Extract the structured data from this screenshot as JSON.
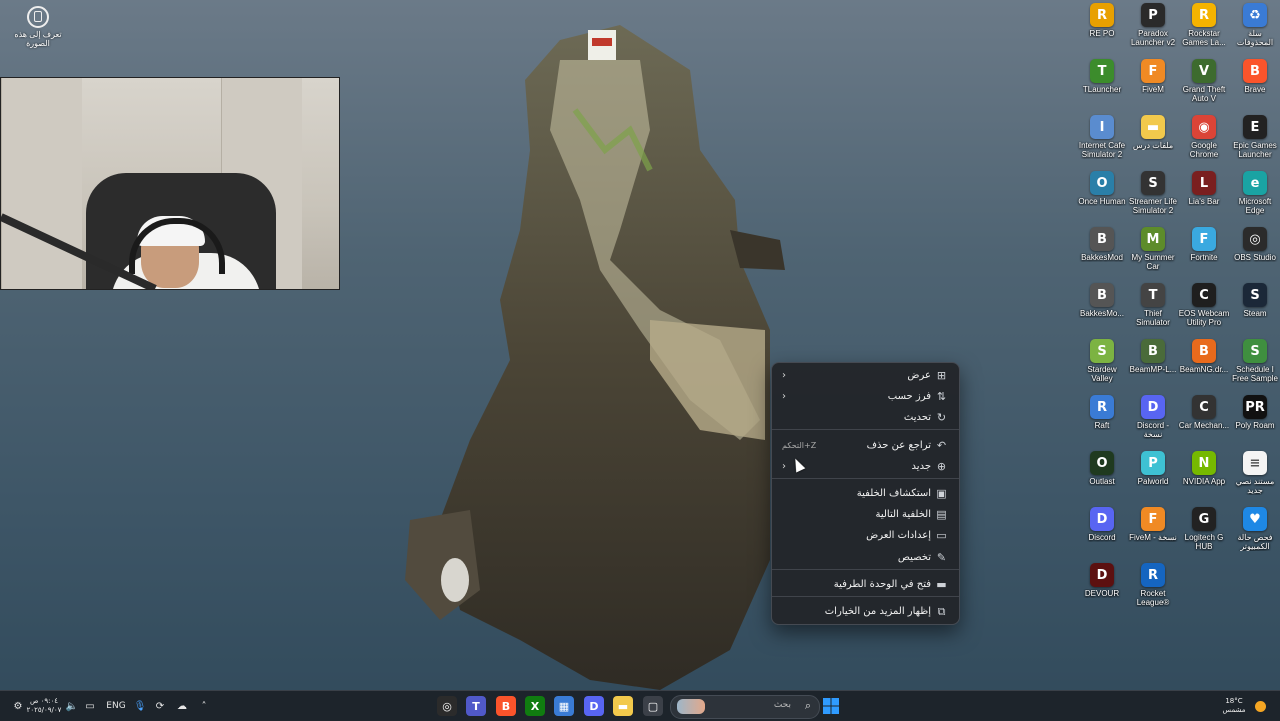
{
  "colors": {
    "menu_bg": "#22252a",
    "taskbar_bg": "#1c2228",
    "windows_blue": "#2f9bff",
    "sea": "#3e5667"
  },
  "desktop": {
    "top_left_icon": {
      "icon": "recycle-circle-icon",
      "label": "تعرف إلى هذه الصورة"
    },
    "icons": [
      {
        "label": "RE PO",
        "icon": "game-icon",
        "color": "#e8a000",
        "glyph": "R"
      },
      {
        "label": "Paradox Launcher v2",
        "icon": "launcher-icon",
        "color": "#2a2a2a",
        "glyph": "P"
      },
      {
        "label": "Rockstar Games La...",
        "icon": "rockstar-icon",
        "color": "#f5b300",
        "glyph": "R"
      },
      {
        "label": "سلة المحذوفات",
        "icon": "recycle-bin-icon",
        "color": "#3a7bd5",
        "glyph": "♻"
      },
      {
        "label": "TLauncher",
        "icon": "tlauncher-icon",
        "color": "#3c8c2c",
        "glyph": "T"
      },
      {
        "label": "FiveM",
        "icon": "fivem-icon",
        "color": "#f08a24",
        "glyph": "F"
      },
      {
        "label": "Grand Theft Auto V",
        "icon": "gta-icon",
        "color": "#3d6b2e",
        "glyph": "V"
      },
      {
        "label": "Brave",
        "icon": "brave-icon",
        "color": "#fb542b",
        "glyph": "B"
      },
      {
        "label": "Internet Cafe Simulator 2",
        "icon": "cafe-icon",
        "color": "#5a8ccf",
        "glyph": "I"
      },
      {
        "label": "ملفات درس",
        "icon": "folder-icon",
        "color": "#f2c94c",
        "glyph": "▬"
      },
      {
        "label": "Google Chrome",
        "icon": "chrome-icon",
        "color": "#db4437",
        "glyph": "◉"
      },
      {
        "label": "Epic Games Launcher",
        "icon": "epic-icon",
        "color": "#222",
        "glyph": "E"
      },
      {
        "label": "Once Human",
        "icon": "oncehuman-icon",
        "color": "#2a7fa8",
        "glyph": "O"
      },
      {
        "label": "Streamer Life Simulator 2",
        "icon": "streamer-icon",
        "color": "#333",
        "glyph": "S"
      },
      {
        "label": "Lia's Bar",
        "icon": "liar-icon",
        "color": "#7a1f1f",
        "glyph": "L"
      },
      {
        "label": "Microsoft Edge",
        "icon": "edge-icon",
        "color": "#1aa3a3",
        "glyph": "e"
      },
      {
        "label": "BakkesMod",
        "icon": "bakkes-icon",
        "color": "#555",
        "glyph": "B"
      },
      {
        "label": "My Summer Car",
        "icon": "summercar-icon",
        "color": "#5d8c2a",
        "glyph": "M"
      },
      {
        "label": "Fortnite",
        "icon": "fortnite-icon",
        "color": "#3aa9e0",
        "glyph": "F"
      },
      {
        "label": "OBS Studio",
        "icon": "obs-icon",
        "color": "#2b2b2b",
        "glyph": "◎"
      },
      {
        "label": "BakkesMo...",
        "icon": "bakkes-icon",
        "color": "#555",
        "glyph": "B"
      },
      {
        "label": "Thief Simulator",
        "icon": "thief-icon",
        "color": "#444",
        "glyph": "T"
      },
      {
        "label": "EOS Webcam Utility Pro",
        "icon": "webcam-icon",
        "color": "#1f1f1f",
        "glyph": "C"
      },
      {
        "label": "Steam",
        "icon": "steam-icon",
        "color": "#1b2838",
        "glyph": "S"
      },
      {
        "label": "Stardew Valley",
        "icon": "stardew-icon",
        "color": "#7cb342",
        "glyph": "S"
      },
      {
        "label": "BeamMP-L...",
        "icon": "beammp-icon",
        "color": "#4a6b3a",
        "glyph": "B"
      },
      {
        "label": "BeamNG.dr...",
        "icon": "beamng-icon",
        "color": "#e86a1c",
        "glyph": "B"
      },
      {
        "label": "Schedule I Free Sample",
        "icon": "schedule-icon",
        "color": "#3f8f3f",
        "glyph": "S"
      },
      {
        "label": "Raft",
        "icon": "raft-icon",
        "color": "#3a7bd5",
        "glyph": "R"
      },
      {
        "label": "Discord - نسخة",
        "icon": "discord-icon",
        "color": "#5865f2",
        "glyph": "D"
      },
      {
        "label": "Car Mechan...",
        "icon": "car-icon",
        "color": "#333",
        "glyph": "C"
      },
      {
        "label": "Poly Roam",
        "icon": "polyroam-icon",
        "color": "#111",
        "glyph": "PR"
      },
      {
        "label": "Outlast",
        "icon": "outlast-icon",
        "color": "#1f3a1f",
        "glyph": "O"
      },
      {
        "label": "Palworld",
        "icon": "palworld-icon",
        "color": "#3ec1d3",
        "glyph": "P"
      },
      {
        "label": "NVIDIA App",
        "icon": "nvidia-icon",
        "color": "#76b900",
        "glyph": "N"
      },
      {
        "label": "مستند نصي جديد",
        "icon": "textfile-icon",
        "color": "#f4f4f4",
        "glyph": "≡"
      },
      {
        "label": "Discord",
        "icon": "discord-icon",
        "color": "#5865f2",
        "glyph": "D"
      },
      {
        "label": "FiveM - نسخة",
        "icon": "fivem-icon",
        "color": "#f08a24",
        "glyph": "F"
      },
      {
        "label": "Logitech G HUB",
        "icon": "ghub-icon",
        "color": "#222",
        "glyph": "G"
      },
      {
        "label": "فحص حالة الكمبيوتر",
        "icon": "pchealth-icon",
        "color": "#1e88e5",
        "glyph": "♥"
      },
      {
        "label": "DEVOUR",
        "icon": "devour-icon",
        "color": "#5c1010",
        "glyph": "D"
      },
      {
        "label": "Rocket League®",
        "icon": "rocketleague-icon",
        "color": "#1565c0",
        "glyph": "R"
      }
    ]
  },
  "context_menu": {
    "items": [
      {
        "label": "عرض",
        "icon": "grid-icon",
        "glyph": "⊞",
        "submenu": true
      },
      {
        "label": "فرز حسب",
        "icon": "sort-icon",
        "glyph": "⇅",
        "submenu": true
      },
      {
        "label": "تحديث",
        "icon": "refresh-icon",
        "glyph": "↻",
        "submenu": false
      },
      {
        "label": "تراجع عن حذف",
        "icon": "undo-icon",
        "glyph": "↶",
        "shortcut": "Z+التحكم"
      },
      {
        "label": "جديد",
        "icon": "new-icon",
        "glyph": "⊕",
        "submenu": true
      },
      {
        "label": "استكشاف الخلفية",
        "icon": "image-icon",
        "glyph": "▣",
        "submenu": false
      },
      {
        "label": "الخلفية التالية",
        "icon": "next-wallpaper-icon",
        "glyph": "▤",
        "submenu": false
      },
      {
        "label": "إعدادات العرض",
        "icon": "display-icon",
        "glyph": "▭",
        "submenu": false
      },
      {
        "label": "تخصيص",
        "icon": "pen-icon",
        "glyph": "✎",
        "submenu": false
      },
      {
        "label": "فتح في الوحدة الطرفية",
        "icon": "terminal-icon",
        "glyph": "▬",
        "submenu": false
      },
      {
        "label": "إظهار المزيد من الخيارات",
        "icon": "more-options-icon",
        "glyph": "⧉",
        "submenu": false
      }
    ]
  },
  "taskbar": {
    "clock": {
      "time": "٠٩:٠٤ ص",
      "date": "٢٠٢٥/٠٩/٠٧"
    },
    "language": "ENG",
    "search_placeholder": "بحث",
    "weather": {
      "temp": "18°C",
      "condition": "مشمس"
    },
    "apps": [
      {
        "icon": "obs-icon",
        "color": "#2b2b2b",
        "glyph": "◎"
      },
      {
        "icon": "teams-icon",
        "color": "#5059c9",
        "glyph": "T"
      },
      {
        "icon": "brave-icon",
        "color": "#fb542b",
        "glyph": "B"
      },
      {
        "icon": "xbox-icon",
        "color": "#107c10",
        "glyph": "X"
      },
      {
        "icon": "store-icon",
        "color": "#3a7bd5",
        "glyph": "▦"
      },
      {
        "icon": "discord-icon",
        "color": "#5865f2",
        "glyph": "D"
      },
      {
        "icon": "explorer-icon",
        "color": "#f2c94c",
        "glyph": "▬"
      },
      {
        "icon": "taskview-icon",
        "color": "#3b4048",
        "glyph": "▢"
      }
    ]
  }
}
